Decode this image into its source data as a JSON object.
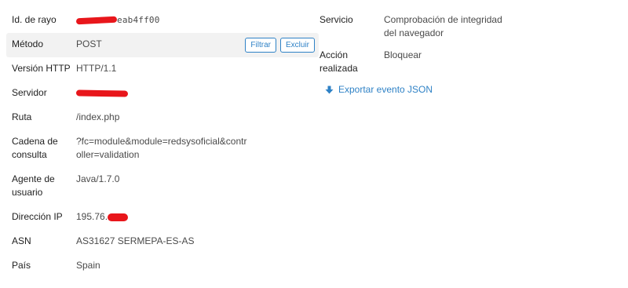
{
  "details": {
    "ray_id": {
      "label": "Id. de rayo",
      "value_visible": "eab4ff00"
    },
    "method": {
      "label": "Método",
      "value": "POST"
    },
    "filter_button": "Filtrar",
    "exclude_button": "Excluir",
    "http_version": {
      "label": "Versión HTTP",
      "value": "HTTP/1.1"
    },
    "server": {
      "label": "Servidor"
    },
    "path": {
      "label": "Ruta",
      "value": "/index.php"
    },
    "query_string": {
      "label": "Cadena de consulta",
      "value": "?fc=module&module=redsysoficial&controller=validation"
    },
    "user_agent": {
      "label": "Agente de usuario",
      "value": "Java/1.7.0"
    },
    "ip_address": {
      "label": "Dirección IP",
      "value_visible": "195.76."
    },
    "asn": {
      "label": "ASN",
      "value": "AS31627 SERMEPA-ES-AS"
    },
    "country": {
      "label": "País",
      "value": "Spain"
    }
  },
  "summary": {
    "service": {
      "label": "Servicio",
      "value": "Comprobación de integridad del navegador"
    },
    "action": {
      "label": "Acción realizada",
      "value": "Bloquear"
    },
    "export_link": "Exportar evento JSON",
    "export_icon": "download-arrow-icon"
  },
  "colors": {
    "accent": "#2f82c6",
    "redaction": "#e8161b",
    "shaded_row": "#f2f2f2"
  }
}
